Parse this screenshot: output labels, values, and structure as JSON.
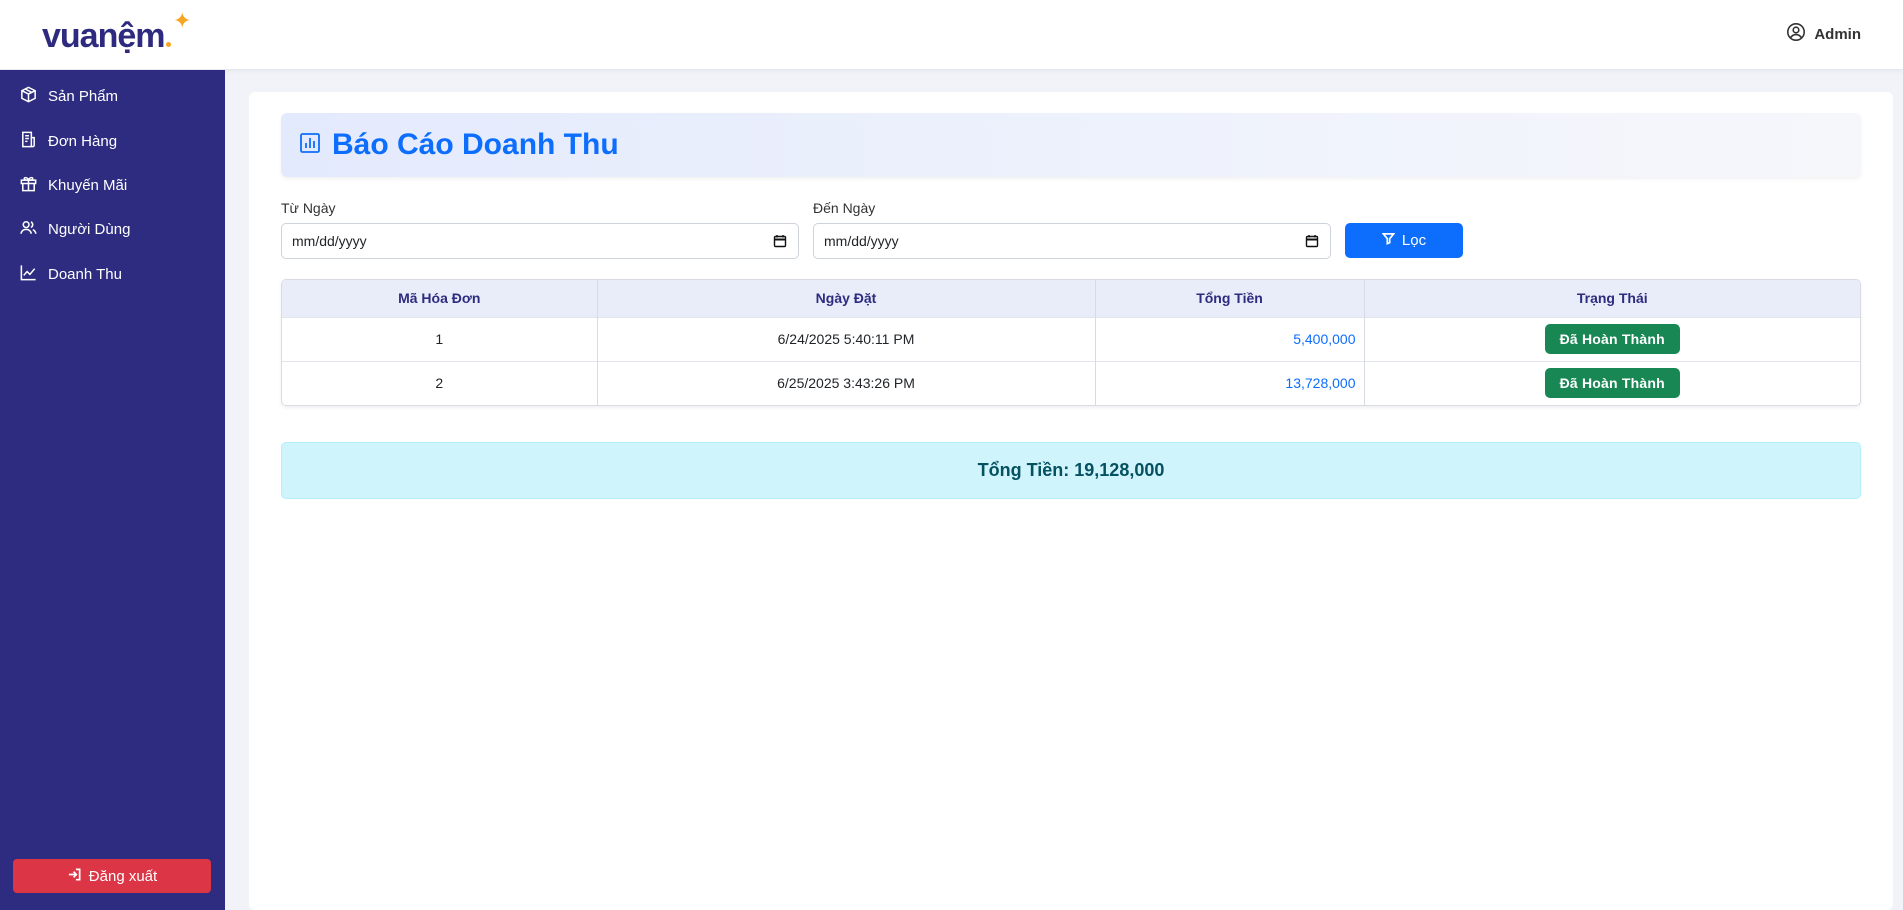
{
  "brand": {
    "logo_text": "vuanệm"
  },
  "header": {
    "user_label": "Admin"
  },
  "sidebar": {
    "items": [
      {
        "label": "Sản Phẩm",
        "icon": "box-icon"
      },
      {
        "label": "Đơn Hàng",
        "icon": "receipt-icon"
      },
      {
        "label": "Khuyến Mãi",
        "icon": "gift-icon"
      },
      {
        "label": "Người Dùng",
        "icon": "users-icon"
      },
      {
        "label": "Doanh Thu",
        "icon": "chart-line-icon"
      }
    ],
    "logout_label": "Đăng xuất"
  },
  "page": {
    "title": "Báo Cáo Doanh Thu"
  },
  "filter": {
    "from_label": "Từ Ngày",
    "from_placeholder": "mm/dd/yyyy",
    "to_label": "Đến Ngày",
    "to_placeholder": "mm/dd/yyyy",
    "button_label": "Lọc"
  },
  "table": {
    "headers": [
      "Mã Hóa Đơn",
      "Ngày Đặt",
      "Tổng Tiền",
      "Trạng Thái"
    ],
    "rows": [
      {
        "id": "1",
        "date": "6/24/2025 5:40:11 PM",
        "amount": "5,400,000",
        "status": "Đã Hoàn Thành"
      },
      {
        "id": "2",
        "date": "6/25/2025 3:43:26 PM",
        "amount": "13,728,000",
        "status": "Đã Hoàn Thành"
      }
    ]
  },
  "summary": {
    "total_text": "Tổng Tiền: 19,128,000"
  },
  "colors": {
    "sidebar": "#2d2c80",
    "primary": "#0d6efd",
    "success": "#198754",
    "danger": "#dc3545",
    "info_bg": "#cff4fc",
    "accent_star": "#f5a623"
  }
}
